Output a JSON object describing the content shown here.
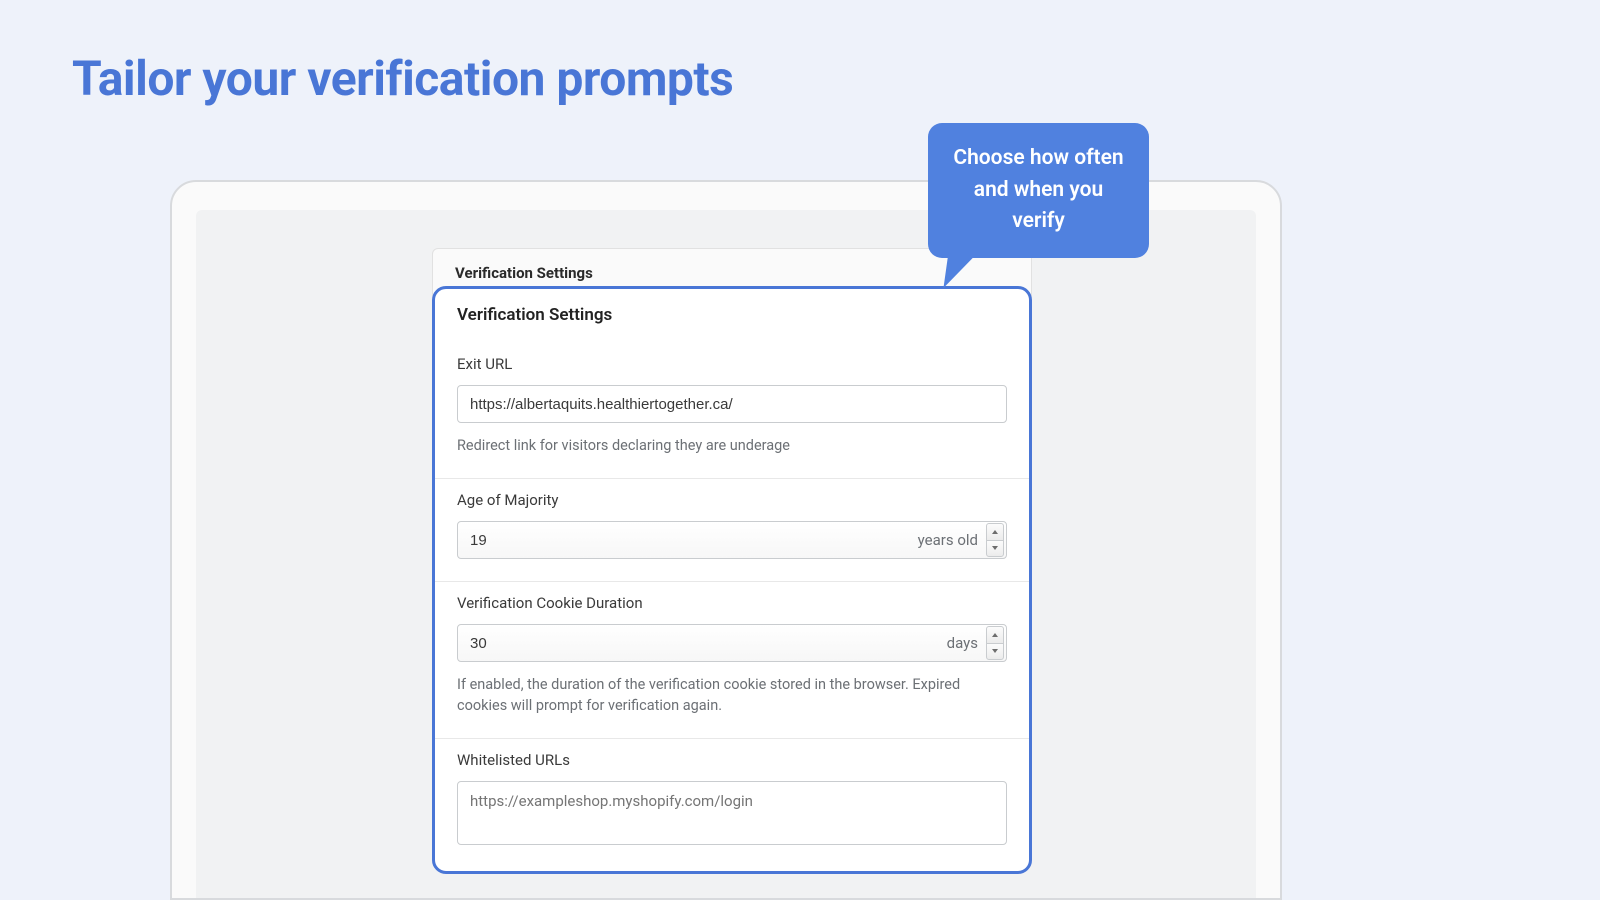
{
  "pageTitle": "Tailor your verification prompts",
  "callout": "Choose how often and when you verify",
  "tab": {
    "label": "Verification Settings"
  },
  "panel": {
    "title": "Verification Settings",
    "exitUrl": {
      "label": "Exit URL",
      "value": "https://albertaquits.healthiertogether.ca/",
      "helper": "Redirect link for visitors declaring they are underage"
    },
    "ageMajority": {
      "label": "Age of Majority",
      "value": "19",
      "unit": "years old"
    },
    "cookieDuration": {
      "label": "Verification Cookie Duration",
      "value": "30",
      "unit": "days",
      "helper": "If enabled, the duration of the verification cookie stored in the browser. Expired cookies will prompt for verification again."
    },
    "whitelist": {
      "label": "Whitelisted URLs",
      "placeholder": "https://exampleshop.myshopify.com/login"
    }
  }
}
